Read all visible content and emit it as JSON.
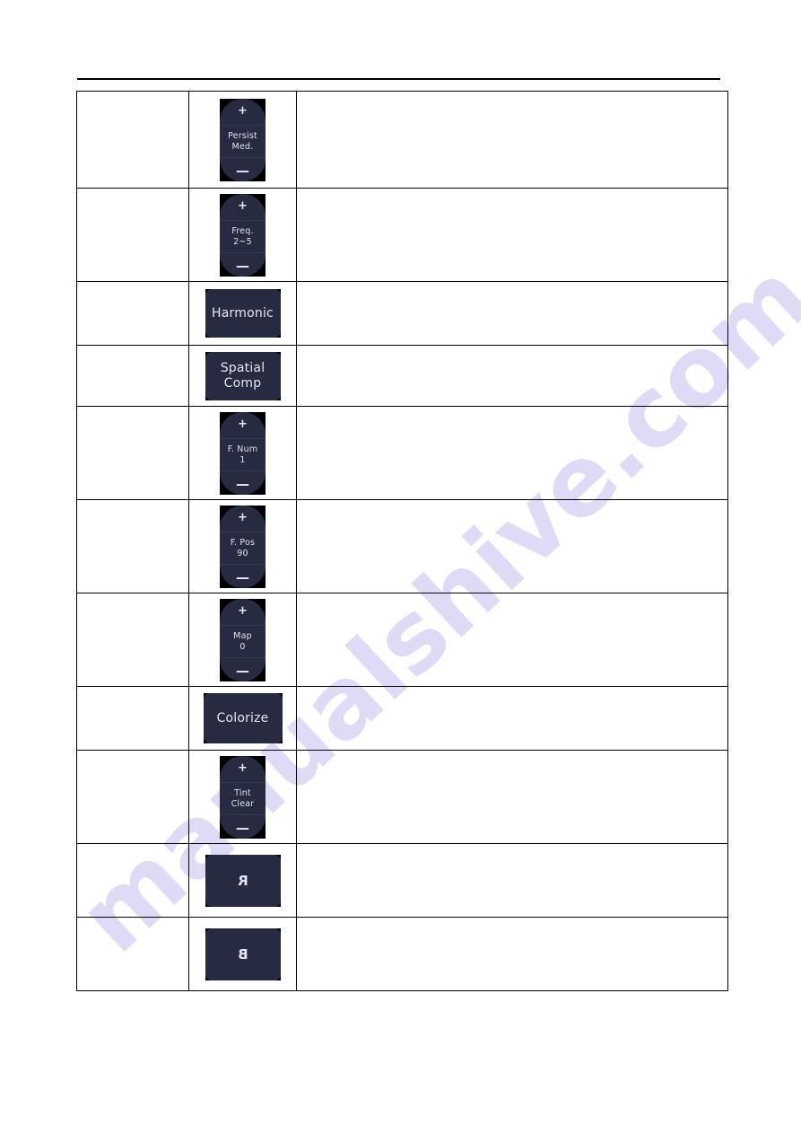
{
  "page": {
    "watermark_text": "manualshive.com",
    "watermark_color": "#5b4fd6",
    "rule_color": "#000000",
    "button_face_color": "#262b41",
    "button_bg_color": "#000000",
    "button_text_color": "#e4e7f1"
  },
  "table": {
    "rows": [
      {
        "id": "persist",
        "description": "",
        "explanation": "",
        "button": {
          "kind": "rocker",
          "plus": "+",
          "minus": "—",
          "label_line1": "Persist",
          "label_line2": "Med."
        }
      },
      {
        "id": "freq",
        "description": "",
        "explanation": "",
        "button": {
          "kind": "rocker",
          "plus": "+",
          "minus": "—",
          "label_line1": "Freq.",
          "label_line2": "2~5"
        }
      },
      {
        "id": "harmonic",
        "description": "",
        "explanation": "",
        "button": {
          "kind": "flat",
          "size": "harmonic",
          "label_line1": "Harmonic",
          "label_line2": ""
        }
      },
      {
        "id": "spatial-comp",
        "description": "",
        "explanation": "",
        "button": {
          "kind": "flat",
          "size": "spatial",
          "label_line1": "Spatial",
          "label_line2": "Comp"
        }
      },
      {
        "id": "f-num",
        "description": "",
        "explanation": "",
        "button": {
          "kind": "rocker",
          "plus": "+",
          "minus": "—",
          "label_line1": "F. Num",
          "label_line2": "1"
        }
      },
      {
        "id": "f-pos",
        "description": "",
        "explanation": "",
        "button": {
          "kind": "rocker",
          "plus": "+",
          "minus": "—",
          "label_line1": "F. Pos",
          "label_line2": "90"
        }
      },
      {
        "id": "map",
        "description": "",
        "explanation": "",
        "button": {
          "kind": "rocker",
          "plus": "+",
          "minus": "—",
          "label_line1": "Map",
          "label_line2": "0"
        }
      },
      {
        "id": "colorize",
        "description": "",
        "explanation": "",
        "button": {
          "kind": "flat",
          "size": "colorize",
          "label_line1": "Colorize",
          "label_line2": ""
        }
      },
      {
        "id": "tint",
        "description": "",
        "explanation": "",
        "button": {
          "kind": "rocker",
          "plus": "+",
          "minus": "—",
          "label_line1": "Tint",
          "label_line2": "Clear"
        }
      },
      {
        "id": "r-flip",
        "description": "",
        "explanation": "",
        "button": {
          "kind": "flat-letter",
          "size": "letter",
          "label_line1": "R",
          "label_line2": ""
        }
      },
      {
        "id": "b-flip",
        "description": "",
        "explanation": "",
        "button": {
          "kind": "flat-letter",
          "size": "letter",
          "label_line1": "B",
          "label_line2": ""
        }
      }
    ]
  }
}
